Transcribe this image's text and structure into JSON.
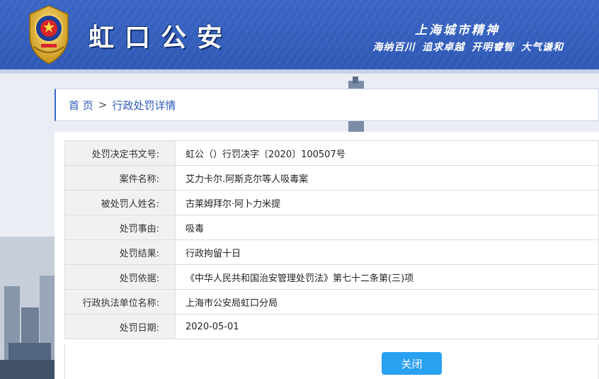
{
  "header": {
    "title": "虹口公安",
    "slogan_line1": "上海城市精神",
    "slogan_line2": "海纳百川 追求卓越 开明睿智 大气谦和",
    "emblem": "police-emblem-icon"
  },
  "breadcrumb": {
    "home": "首 页",
    "separator": ">",
    "current": "行政处罚详情"
  },
  "details": [
    {
      "label": "处罚决定书文号:",
      "value": "虹公（）行罚决字〔2020〕100507号"
    },
    {
      "label": "案件名称:",
      "value": "艾力卡尔.阿斯克尔等人吸毒案"
    },
    {
      "label": "被处罚人姓名:",
      "value": "古莱姆拜尔·阿卜力米提"
    },
    {
      "label": "处罚事由:",
      "value": "吸毒"
    },
    {
      "label": "处罚结果:",
      "value": "行政拘留十日"
    },
    {
      "label": "处罚依据:",
      "value": "《中华人民共和国治安管理处罚法》第七十二条第(三)项"
    },
    {
      "label": "行政执法单位名称:",
      "value": "上海市公安局虹口分局"
    },
    {
      "label": "处罚日期:",
      "value": "2020-05-01"
    }
  ],
  "actions": {
    "close_label": "关闭"
  },
  "colors": {
    "header_blue": "#3a66c4",
    "button_blue": "#2aa0f0",
    "link_blue": "#2f5bb7"
  }
}
